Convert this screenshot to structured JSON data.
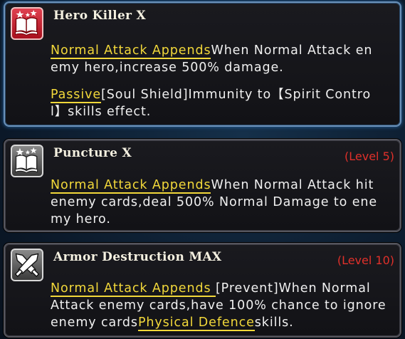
{
  "skills": [
    {
      "title": "Hero Killer X",
      "level": "",
      "line1_kw": "Normal Attack Appends",
      "line1_text": "When Normal Attack en",
      "line2_text": "emy hero,increase 500% damage.",
      "line3_kw": "Passive",
      "line3_text": "[Soul Shield]Immunity to【Spirit Contro",
      "line4_text": "l】skills effect."
    },
    {
      "title": "Puncture X",
      "level": "(Level 5)",
      "line1_kw": "Normal Attack Appends",
      "line1_text": "When Normal Attack hit",
      "line2_text": "enemy cards,deal 500% Normal Damage to ene",
      "line3_text": "my hero."
    },
    {
      "title": "Armor Destruction MAX",
      "level": "(Level 10)",
      "line1_kw": "Normal Attack Appends ",
      "line1_text": "[Prevent]When Normal",
      "line2_text": "Attack enemy cards,have 100% chance to ignore",
      "line3_pre": "enemy cards",
      "line3_kw": "Physical Defence",
      "line3_text": "skills."
    }
  ],
  "colors": {
    "keyword": "#f2d83a",
    "level": "#e0302a",
    "active_border": "#6a90b8"
  },
  "icons": [
    "book-star-icon",
    "book-star-icon",
    "crossed-swords-icon"
  ]
}
